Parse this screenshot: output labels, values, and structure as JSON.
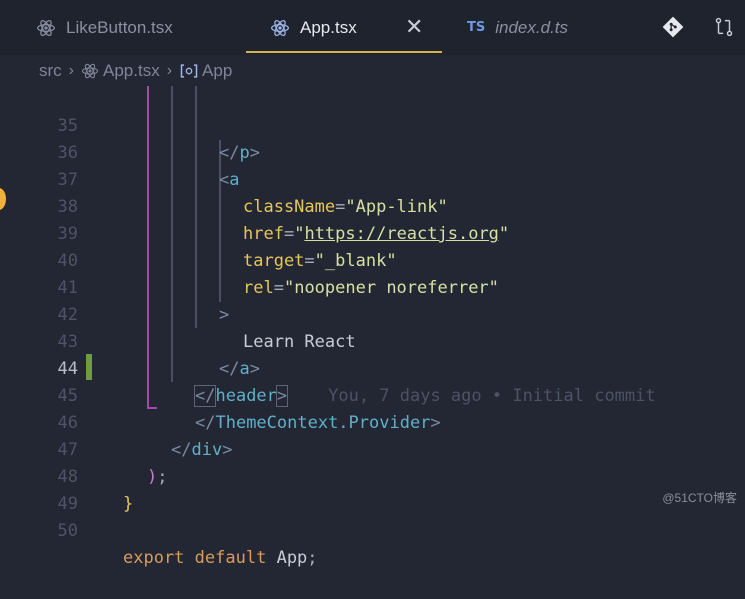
{
  "tabs": [
    {
      "label": "LikeButton.tsx",
      "icon": "react-icon",
      "active": false
    },
    {
      "label": "App.tsx",
      "icon": "react-icon",
      "active": true
    },
    {
      "label": "index.d.ts",
      "badge": "TS",
      "active": false
    }
  ],
  "toolbar": {
    "icons": [
      "git-icon",
      "compare-icon"
    ]
  },
  "breadcrumb": {
    "folder": "src",
    "file": "App.tsx",
    "symbol": "App"
  },
  "line_numbers": [
    "35",
    "36",
    "37",
    "38",
    "39",
    "40",
    "41",
    "42",
    "43",
    "44",
    "45",
    "46",
    "47",
    "48",
    "49",
    "50"
  ],
  "code": {
    "l35": {
      "open": "</",
      "tag": "p",
      "close": ">"
    },
    "l36": {
      "open": "<",
      "tag": "a"
    },
    "l37": {
      "attr": "className",
      "eq": "=",
      "value": "\"App-link\""
    },
    "l38": {
      "attr": "href",
      "eq": "=",
      "q1": "\"",
      "url": "https://reactjs.org",
      "q2": "\""
    },
    "l39": {
      "attr": "target",
      "eq": "=",
      "value": "\"_blank\""
    },
    "l40": {
      "attr": "rel",
      "eq": "=",
      "value": "\"noopener noreferrer\""
    },
    "l41": {
      "close": ">"
    },
    "l42": {
      "text": "Learn React"
    },
    "l43": {
      "open": "</",
      "tag": "a",
      "close": ">"
    },
    "l44": {
      "open": "</",
      "tag": "header",
      "close": ">",
      "blame": "You, 7 days ago • Initial commit"
    },
    "l45": {
      "open": "</",
      "tag": "ThemeContext.Provider",
      "close": ">"
    },
    "l46": {
      "open": "</",
      "tag": "div",
      "close": ">"
    },
    "l47": {
      "paren": ")",
      "semi": ";"
    },
    "l48": {
      "brace": "}"
    },
    "l50": {
      "kw1": "export",
      "kw2": "default",
      "ident": "App",
      "semi": ";"
    }
  },
  "watermark": "@51CTO博客",
  "colors": {
    "background": "#232733",
    "accent": "#d6b24a",
    "tag": "#5fb0c9",
    "attr": "#e6c65a",
    "string": "#d7e0a2"
  }
}
